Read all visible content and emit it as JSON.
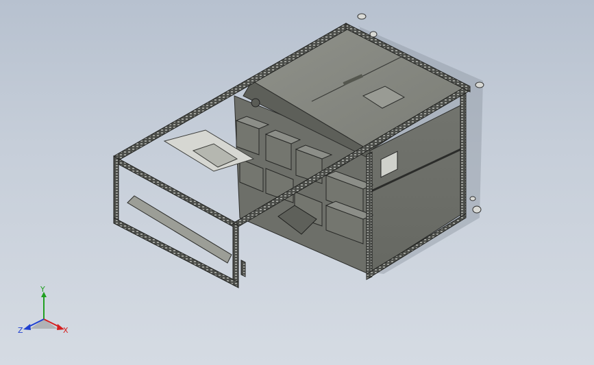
{
  "viewport": {
    "background_top": "#b7c1cf",
    "background_bottom": "#d5dbe3"
  },
  "triad": {
    "x_label": "X",
    "y_label": "Y",
    "z_label": "Z",
    "x_color": "#d42020",
    "y_color": "#20a020",
    "z_color": "#2040d0"
  }
}
